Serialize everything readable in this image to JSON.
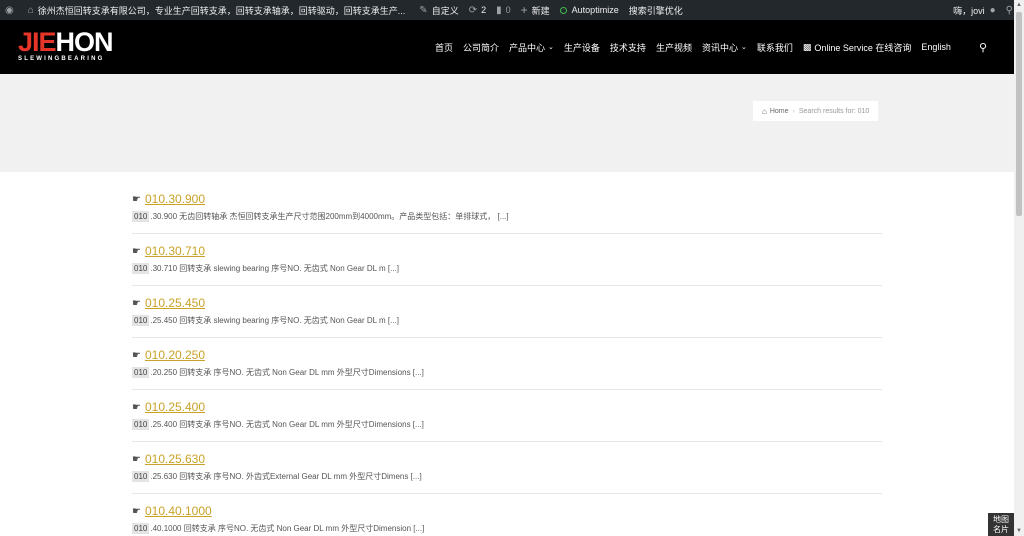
{
  "adminbar": {
    "site_name": "徐州杰恒回转支承有限公司，专业生产回转支承，回转支承轴承，回转驱动，回转支承生产...",
    "customize": "自定义",
    "updates_count": "2",
    "comments_count": "0",
    "new_label": "新建",
    "autoptimize": "Autoptimize",
    "seo": "搜索引擎优化",
    "greeting": "嗨，jovi"
  },
  "header": {
    "logo_red": "JIE",
    "logo_white": "HON",
    "logo_sub": "SLEWINGBEARING",
    "nav": [
      {
        "label": "首页"
      },
      {
        "label": "公司简介"
      },
      {
        "label": "产品中心",
        "dropdown": true
      },
      {
        "label": "生产设备"
      },
      {
        "label": "技术支持"
      },
      {
        "label": "生产视频"
      },
      {
        "label": "资讯中心",
        "dropdown": true
      },
      {
        "label": "联系我们"
      },
      {
        "label": "Online Service 在线咨询"
      },
      {
        "label": "English"
      }
    ]
  },
  "breadcrumb": {
    "home": "Home",
    "current": "Search results for: 010"
  },
  "results": [
    {
      "title": "010.30.900",
      "highlight": "010",
      "excerpt": ".30.900 无齿回转轴承 杰恒回转支承生产尺寸范围200mm到4000mm。产品类型包括：单排球式，  [...]"
    },
    {
      "title": "010.30.710",
      "highlight": "010",
      "excerpt": ".30.710 回转支承 slewing bearing 序号NO. 无齿式 Non Gear DL m [...]"
    },
    {
      "title": "010.25.450",
      "highlight": "010",
      "excerpt": ".25.450 回转支承 slewing bearing 序号NO. 无齿式 Non Gear DL m [...]"
    },
    {
      "title": "010.20.250",
      "highlight": "010",
      "excerpt": ".20.250 回转支承 序号NO. 无齿式 Non Gear DL mm 外型尺寸Dimensions [...]"
    },
    {
      "title": "010.25.400",
      "highlight": "010",
      "excerpt": ".25.400 回转支承 序号NO. 无齿式 Non Gear DL mm 外型尺寸Dimensions [...]"
    },
    {
      "title": "010.25.630",
      "highlight": "010",
      "excerpt": ".25.630 回转支承 序号NO. 外齿式External Gear DL mm 外型尺寸Dimens [...]"
    },
    {
      "title": "010.40.1000",
      "highlight": "010",
      "excerpt": ".40.1000 回转支承 序号NO. 无齿式 Non Gear DL mm 外型尺寸Dimension [...]"
    }
  ],
  "map_badge": {
    "line1": "地图",
    "line2": "名片"
  }
}
